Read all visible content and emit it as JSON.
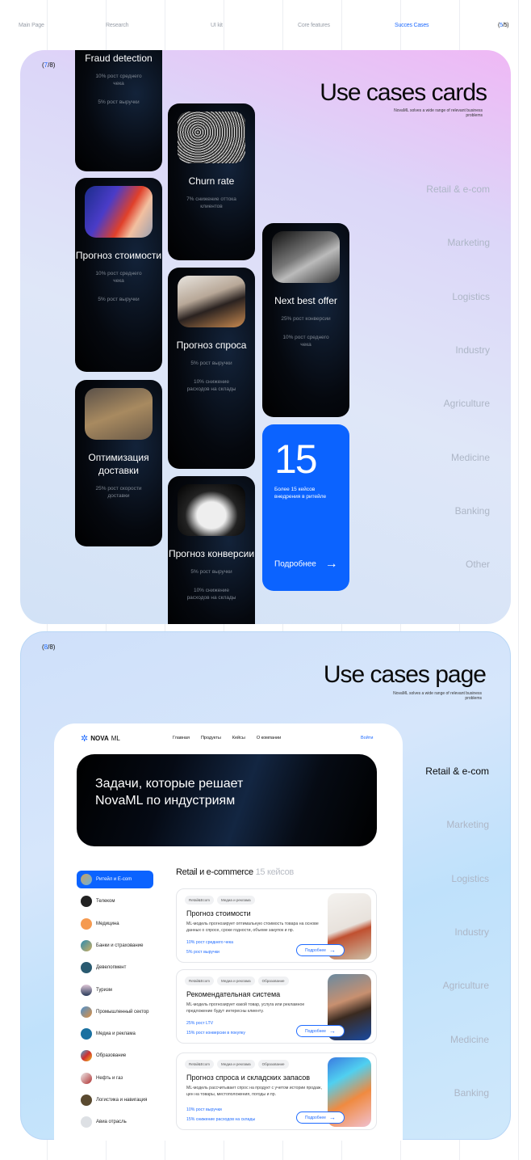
{
  "topnav": {
    "items": [
      "Main Page",
      "Research",
      "UI kit",
      "Core features",
      "Succes Cases"
    ],
    "active": "Succes Cases",
    "counter_current": "5",
    "counter_total": "/5)",
    "counter_open": "("
  },
  "accent": "#0b63ff",
  "panel1": {
    "counter_current": "7",
    "counter_rest": "/8)",
    "counter_open": "(",
    "title": "Use cases cards",
    "subtitle": "NovaML solves a wide range of relevant business problems",
    "industries": [
      "Retail & e-com",
      "Marketing",
      "Logistics",
      "Industry",
      "Agriculture",
      "Medicine",
      "Banking",
      "Other"
    ],
    "cards": [
      {
        "title": "Fraud detection",
        "metrics": [
          "10% рост среднего чека",
          "5% рост выручки"
        ]
      },
      {
        "title": "Прогноз стоимости",
        "metrics": [
          "10% рост среднего чека",
          "5% рост выручки"
        ]
      },
      {
        "title": "Оптимизация доставки",
        "metrics": [
          "25% рост скорости доставки"
        ]
      },
      {
        "title": "Churn rate",
        "metrics": [
          "7% снижение оттока клиентов"
        ]
      },
      {
        "title": "Прогноз спроса",
        "metrics": [
          "5% рост выручки",
          "10% снижение расходов на склады"
        ]
      },
      {
        "title": "Прогноз конверсии",
        "metrics": [
          "5% рост выручки",
          "10% снижение расходов на склады"
        ]
      },
      {
        "title": "Next best offer",
        "metrics": [
          "25% рост конверсии",
          "10% рост среднего чека"
        ]
      }
    ],
    "promo": {
      "number": "15",
      "text": "Более 15 кейсов внедрения в ритейле",
      "link": "Подробнее",
      "arrow": "→"
    }
  },
  "panel2": {
    "counter_current": "8",
    "counter_rest": "/8)",
    "counter_open": "(",
    "title": "Use cases page",
    "subtitle": "NovaML solves a wide range of relevant business problems",
    "industries": [
      "Retail & e-com",
      "Marketing",
      "Logistics",
      "Industry",
      "Agriculture",
      "Medicine",
      "Banking"
    ],
    "active_industry": "Retail & e-com",
    "site": {
      "logo_bold": "NOVA",
      "logo_light": "ML",
      "nav": [
        "Главная",
        "Продукты",
        "Кейсы",
        "О компании"
      ],
      "login": "Войти",
      "hero": "Задачи, которые решает NovaML по индустриям",
      "sidebar": [
        "Ритейл и E-com",
        "Телеком",
        "Медицина",
        "Банки и страхование",
        "Девелопмент",
        "Туризм",
        "Промышленный сектор",
        "Медиа и реклама",
        "Образование",
        "Нефть и газ",
        "Логистика и навигация",
        "Авиа отрасль"
      ],
      "section_title": "Retail и e-commerce",
      "section_count": "15 кейсов",
      "cases": [
        {
          "tags": [
            "Retail&Ecom",
            "Медиа и реклама"
          ],
          "title": "Прогноз стоимости",
          "desc": "ML-модель прогнозирует оптимальную стоимость товара на основе данных о спросе, сроке годности, объеме закупок и пр.",
          "metrics": [
            "10% рост среднего чека",
            "5% рост выручки"
          ],
          "button": "Подробнее"
        },
        {
          "tags": [
            "Retail&Ecom",
            "Медиа и реклама",
            "Образование"
          ],
          "title": "Рекомендательная система",
          "desc": "ML-модель прогнозирует какой товар, услуга или рекламное предложение будут интересны клиенту.",
          "metrics": [
            "25% рост LTV",
            "15% рост конверсии в покупку"
          ],
          "button": "Подробнее"
        },
        {
          "tags": [
            "Retail&Ecom",
            "Медиа и реклама",
            "Образование"
          ],
          "title": "Прогноз спроса и складских запасов",
          "desc": "ML-модель рассчитывает спрос на продукт с учетом истории продаж, цен на товары, местоположения, погоды и пр.",
          "metrics": [
            "10% рост выручки",
            "15% снижение расходов на склады"
          ],
          "button": "Подробнее"
        }
      ]
    }
  }
}
